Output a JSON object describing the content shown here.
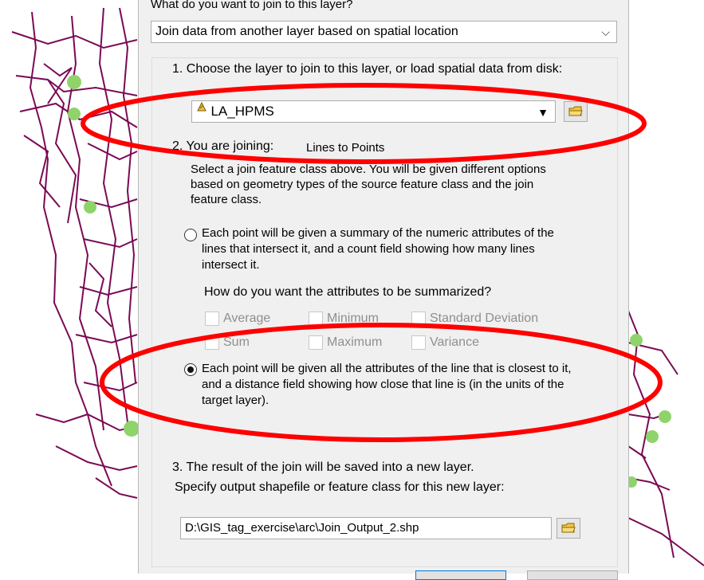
{
  "dialog": {
    "question": "What do you want to join to this layer?",
    "join_type": "Join data from another layer based on spatial location",
    "step1": "1.  Choose the layer to join to this layer, or load spatial data from disk:",
    "layer_value": "LA_HPMS",
    "step2_label": "2.  You are joining:",
    "step2_value": "Lines to Points",
    "step2_desc": "Select a join feature class above.  You will be given different options based on geometry types of the source feature class and the join feature class.",
    "option1": "Each point will be given a summary of the numeric attributes of the lines that intersect it, and a count field showing how many lines intersect it.",
    "summarize_q": "How do you want the attributes to be summarized?",
    "checkboxes": [
      "Average",
      "Minimum",
      "Standard Deviation",
      "Sum",
      "Maximum",
      "Variance"
    ],
    "option2": "Each point will be given all the attributes of the line that is closest to it, and a distance field showing how close that line is (in the units of the target layer).",
    "step3": "3.  The result of the join will be saved into a new layer.",
    "step3_desc": "Specify output shapefile or feature class for this new layer:",
    "output_path": "D:\\GIS_tag_exercise\\arc\\Join_Output_2.shp"
  },
  "colors": {
    "road_line": "#7a0a55",
    "point_marker": "#8ed46a",
    "highlight_ellipse": "#ff0000",
    "dialog_bg": "#f0f0f0"
  }
}
